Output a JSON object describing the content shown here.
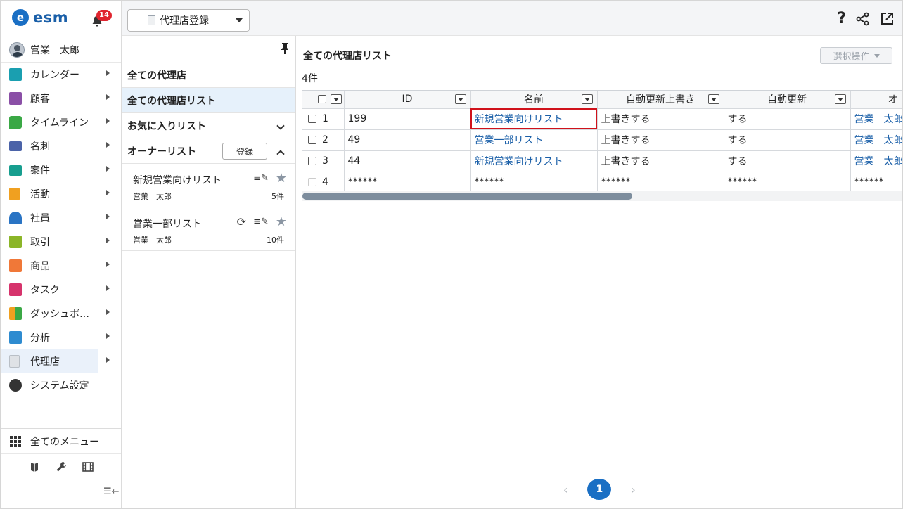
{
  "app": {
    "logo_mark": "e",
    "logo_text": "esm",
    "notification_count": "14",
    "user_name": "営業　太郎"
  },
  "nav": {
    "items": [
      {
        "label": "カレンダー",
        "icon": "calendar-icon",
        "color": "#1a9fb0"
      },
      {
        "label": "顧客",
        "icon": "building-icon",
        "color": "#8a4fa6"
      },
      {
        "label": "タイムライン",
        "icon": "chat-icon",
        "color": "#3aa845"
      },
      {
        "label": "名刺",
        "icon": "card-icon",
        "color": "#4b63a8"
      },
      {
        "label": "案件",
        "icon": "folder-icon",
        "color": "#179e8f"
      },
      {
        "label": "活動",
        "icon": "clipboard-icon",
        "color": "#f0a020"
      },
      {
        "label": "社員",
        "icon": "person-icon",
        "color": "#2a74c4"
      },
      {
        "label": "取引",
        "icon": "ledger-icon",
        "color": "#8bb528"
      },
      {
        "label": "商品",
        "icon": "box-icon",
        "color": "#f07838"
      },
      {
        "label": "タスク",
        "icon": "check-icon",
        "color": "#d6336c"
      },
      {
        "label": "ダッシュボ…",
        "icon": "dashboard-icon",
        "color": "#3a78c8"
      },
      {
        "label": "分析",
        "icon": "chart-icon",
        "color": "#2e8bd0"
      },
      {
        "label": "代理店",
        "icon": "document-icon",
        "color": "#c8ccd2"
      },
      {
        "label": "システム設定",
        "icon": "gear-icon",
        "color": "#333333"
      }
    ],
    "all_menu": "全てのメニュー",
    "collapse": "☰←"
  },
  "header": {
    "register_label": "代理店登録",
    "help": "?"
  },
  "mid": {
    "all_agencies": "全ての代理店",
    "all_agency_list": "全ての代理店リスト",
    "favorites": "お気に入りリスト",
    "owner_list": "オーナーリスト",
    "owner_register": "登録",
    "lists": [
      {
        "title": "新規営業向けリスト",
        "owner": "営業　太郎",
        "count": "5件"
      },
      {
        "title": "営業一部リスト",
        "owner": "営業　太郎",
        "count": "10件"
      }
    ]
  },
  "main": {
    "title": "全ての代理店リスト",
    "bulk_action": "選択操作",
    "count": "4件",
    "columns": [
      "ID",
      "名前",
      "自動更新上書き",
      "自動更新",
      "オ"
    ],
    "rows": [
      {
        "num": "1",
        "id": "199",
        "name": "新規営業向けリスト",
        "overwrite": "上書きする",
        "auto": "する",
        "owner": "営業　太郎"
      },
      {
        "num": "2",
        "id": "49",
        "name": "営業一部リスト",
        "overwrite": "上書きする",
        "auto": "する",
        "owner": "営業　太郎"
      },
      {
        "num": "3",
        "id": "44",
        "name": "新規営業向けリスト",
        "overwrite": "上書きする",
        "auto": "する",
        "owner": "営業　太郎"
      },
      {
        "num": "4",
        "id": "******",
        "name": "******",
        "overwrite": "******",
        "auto": "******",
        "owner": "******"
      }
    ],
    "page_current": "1",
    "scroll_fraction": 0.55
  }
}
